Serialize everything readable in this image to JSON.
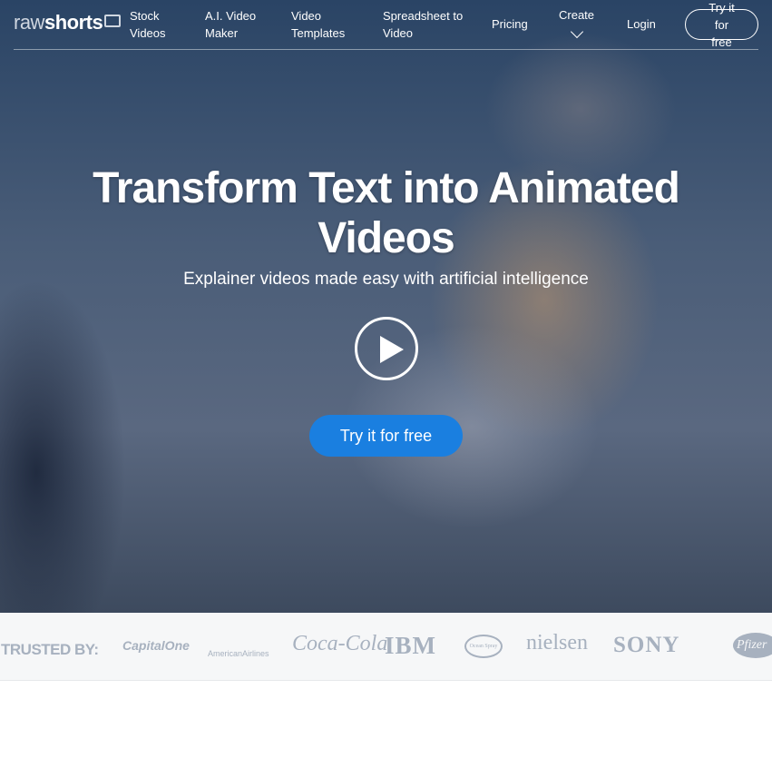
{
  "nav": {
    "logo": {
      "light": "raw",
      "bold": "shorts"
    },
    "items": [
      {
        "label": "Stock Videos"
      },
      {
        "label": "A.I. Video Maker"
      },
      {
        "label": "Video Templates"
      },
      {
        "label": "Spreadsheet to Video"
      },
      {
        "label": "Pricing"
      },
      {
        "label": "Create"
      },
      {
        "label": "Login"
      }
    ],
    "cta": "Try it for free"
  },
  "hero": {
    "title": "Transform Text into Animated Videos",
    "subtitle": "Explainer videos made easy with artificial intelligence",
    "cta": "Try it for free",
    "cta_color": "#1a7fe0"
  },
  "trusted": {
    "label": "TRUSTED BY:",
    "logos": [
      "CapitalOne",
      "AmericanAirlines",
      "Coca-Cola",
      "IBM",
      "Ocean Spray",
      "nielsen",
      "SONY",
      "Pfizer"
    ]
  }
}
